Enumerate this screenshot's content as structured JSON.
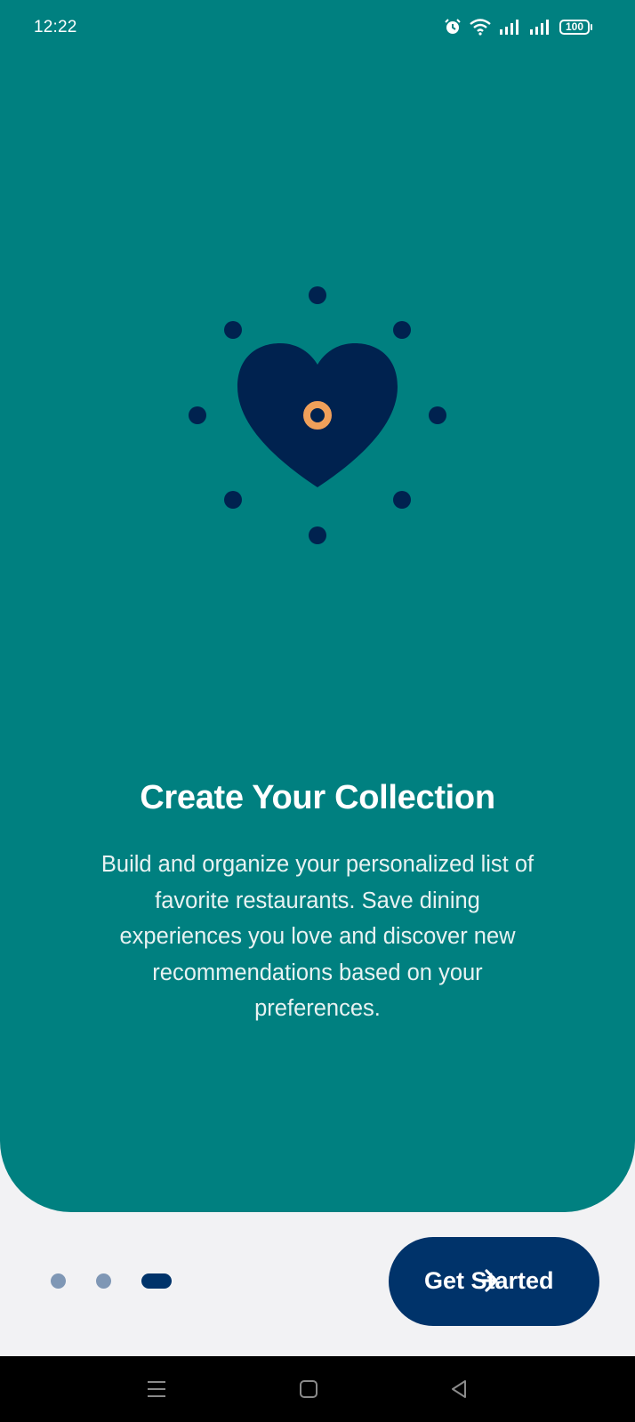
{
  "status_bar": {
    "time": "12:22",
    "battery": "100",
    "icons": [
      "alarm-icon",
      "wifi-icon",
      "signal-icon",
      "signal-icon",
      "battery-icon"
    ]
  },
  "onboarding": {
    "title": "Create Your Collection",
    "description": "Build and organize your personalized list of favorite restaurants. Save dining experiences you love and discover new recommendations based on your preferences.",
    "illustration": "heart-icon",
    "page_indicator": {
      "total": 3,
      "current": 3
    }
  },
  "cta": {
    "label": "Get Started",
    "icon": "arrow-right-icon"
  },
  "nav_bar": {
    "icons": [
      "menu-icon",
      "home-icon",
      "back-icon"
    ]
  },
  "colors": {
    "hero_background": "#008080",
    "primary": "#00336a",
    "accent": "#f0a05a",
    "page_background": "#f2f2f4",
    "inactive_dot": "#7f97b5"
  }
}
